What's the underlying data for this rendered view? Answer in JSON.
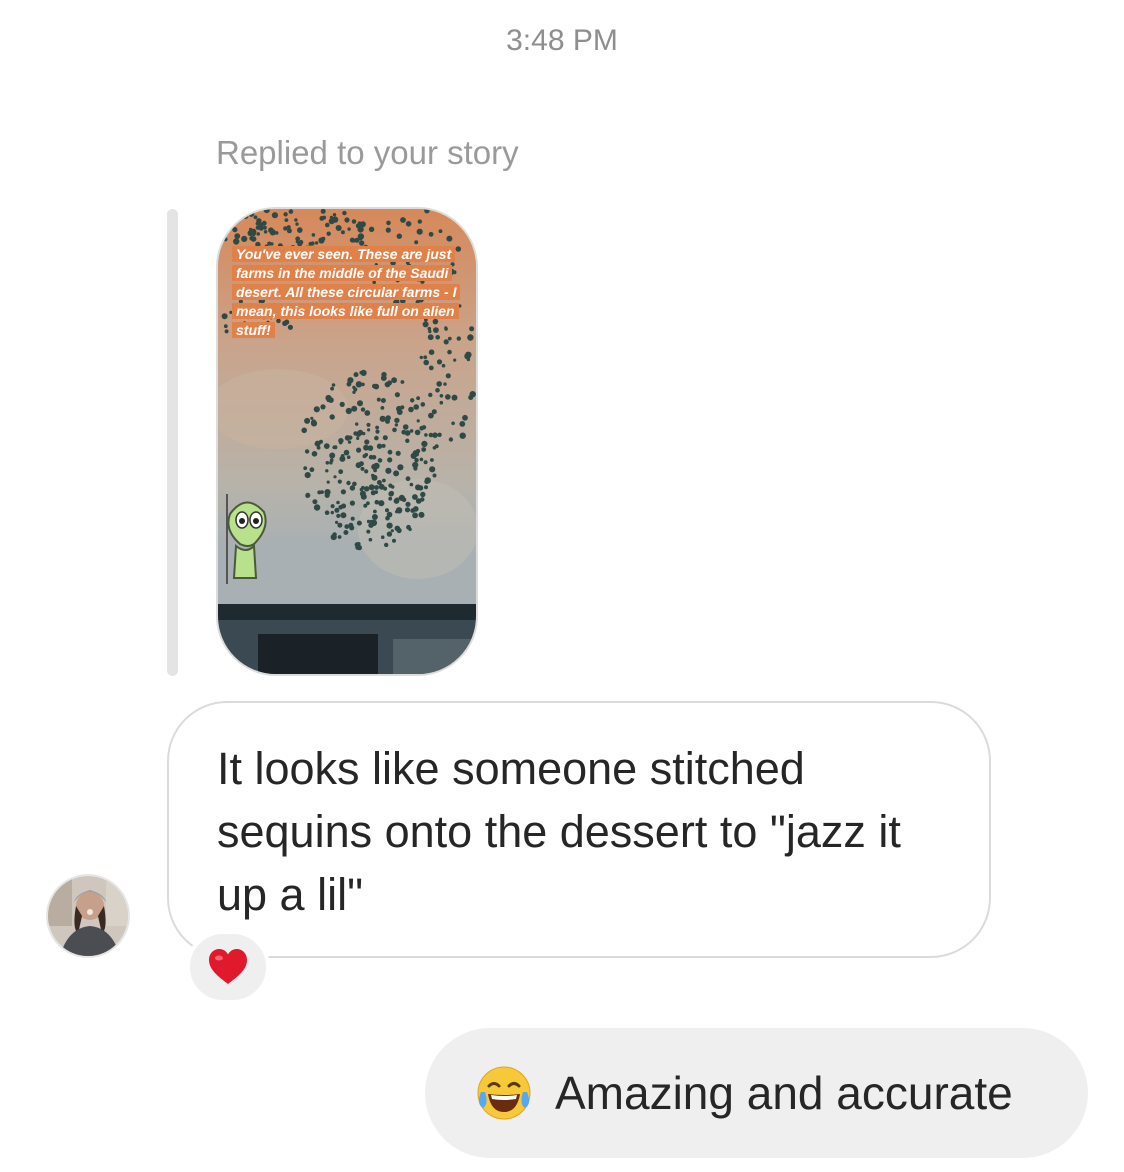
{
  "timestamp": "3:48 PM",
  "reply": {
    "label": "Replied to your story",
    "story_caption": "You've ever seen. These are just farms in the middle of the Saudi desert. All these circular farms - I mean, this looks like full on alien stuff!"
  },
  "received_message": {
    "text": "It looks like someone stitched sequins onto the dessert to \"jazz it up a lil\"",
    "reaction": "heart"
  },
  "sent_message": {
    "emoji": "face-with-tears-of-joy",
    "text": "Amazing and accurate"
  },
  "colors": {
    "timestamp": "#8e8e8e",
    "bubble_border": "#dbdbdb",
    "sent_bubble": "#efefef",
    "text": "#262626",
    "heart": "#e0192c"
  }
}
